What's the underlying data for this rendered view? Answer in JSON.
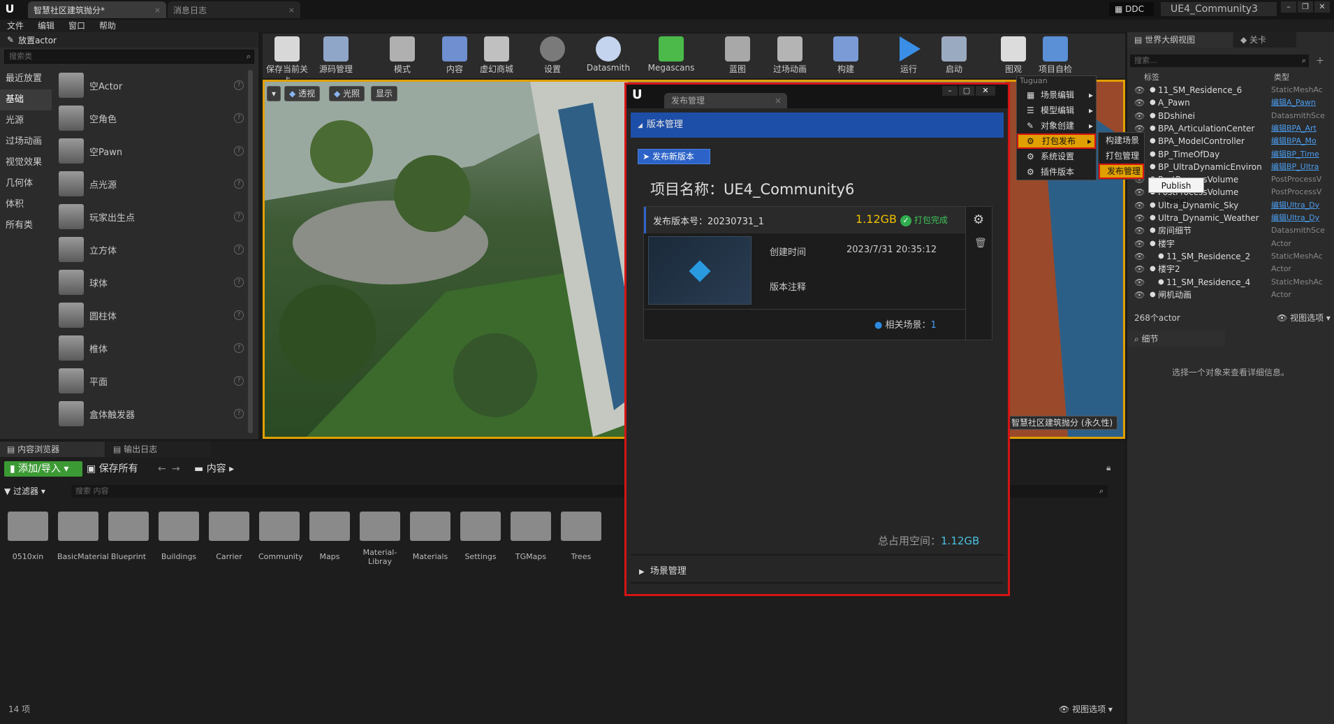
{
  "titlebar": {
    "tabs": [
      "智慧社区建筑抛分*",
      "消息日志"
    ],
    "ddc_label": "DDC",
    "project_name": "UE4_Community3"
  },
  "menubar": [
    "文件",
    "编辑",
    "窗口",
    "帮助"
  ],
  "left_panel": {
    "title": "放置actor",
    "search_placeholder": "搜索类",
    "categories": [
      "最近放置",
      "基础",
      "光源",
      "过场动画",
      "视觉效果",
      "几何体",
      "体积",
      "所有类"
    ],
    "actors": [
      "空Actor",
      "空角色",
      "空Pawn",
      "点光源",
      "玩家出生点",
      "立方体",
      "球体",
      "圆柱体",
      "椎体",
      "平面",
      "盒体触发器"
    ]
  },
  "toolbar": {
    "buttons": [
      "保存当前关卡",
      "源码管理",
      "模式",
      "内容",
      "虚幻商城",
      "设置",
      "Datasmith",
      "Megascans",
      "蓝图",
      "过场动画",
      "构建",
      "运行",
      "启动",
      "图观",
      "项目自检"
    ]
  },
  "viewport": {
    "buttons": [
      "透视",
      "光照",
      "显示"
    ],
    "bottom_label": "智慧社区建筑抛分 (永久性)"
  },
  "dialog": {
    "tab_title": "发布管理",
    "section_version": "版本管理",
    "publish_button": "发布新版本",
    "project_label": "项目名称：UE4_Community6",
    "version_label": "发布版本号：20230731_1",
    "size": "1.12GB",
    "status": "打包完成",
    "created_label": "创建时间",
    "created_value": "2023/7/31 20:35:12",
    "notes_label": "版本注释",
    "related_label": "相关场景：",
    "related_count": "1",
    "total_label": "总占用空间：",
    "total_value": "1.12GB",
    "section_scene": "场景管理"
  },
  "context_menu": {
    "header": "Tuguan",
    "items": [
      "场景编辑",
      "模型编辑",
      "对象创建",
      "打包发布",
      "系统设置",
      "插件版本"
    ],
    "submenu": [
      "构建场景",
      "打包管理",
      "发布管理"
    ],
    "tooltip": "Publish Panel"
  },
  "content_browser": {
    "tabs": [
      "内容浏览器",
      "输出日志"
    ],
    "add_button": "添加/导入",
    "save_all": "保存所有",
    "path": "内容",
    "filter": "过滤器",
    "search_placeholder": "搜索 内容",
    "folders": [
      "0510xin",
      "BasicMaterial",
      "Blueprint",
      "Buildings",
      "Carrier",
      "Community",
      "Maps",
      "Material-Libray",
      "Materials",
      "Settings",
      "TGMaps",
      "Trees"
    ],
    "item_count": "14 项",
    "view_options": "视图选项"
  },
  "outliner": {
    "tabs": [
      "世界大纲视图",
      "关卡"
    ],
    "search_placeholder": "搜索...",
    "col_label": "标签",
    "col_type": "类型",
    "rows": [
      {
        "name": "11_SM_Residence_6",
        "type": "StaticMeshAc",
        "link": false
      },
      {
        "name": "A_Pawn",
        "type": "编辑A_Pawn",
        "link": true
      },
      {
        "name": "BDshinei",
        "type": "DatasmithSce",
        "link": false
      },
      {
        "name": "BPA_ArticulationCenter",
        "type": "编辑BPA_Art",
        "link": true
      },
      {
        "name": "BPA_ModelController",
        "type": "编辑BPA_Mo",
        "link": true
      },
      {
        "name": "BP_TimeOfDay",
        "type": "编辑BP_Time",
        "link": true
      },
      {
        "name": "BP_UltraDynamicEnviron",
        "type": "编辑BP_Ultra",
        "link": true
      },
      {
        "name": "PostProcessVolume",
        "type": "PostProcessV",
        "link": false
      },
      {
        "name": "PostProcessVolume",
        "type": "PostProcessV",
        "link": false
      },
      {
        "name": "Ultra_Dynamic_Sky",
        "type": "编辑Ultra_Dy",
        "link": true
      },
      {
        "name": "Ultra_Dynamic_Weather",
        "type": "编辑Ultra_Dy",
        "link": true
      },
      {
        "name": "房间细节",
        "type": "DatasmithSce",
        "link": false
      },
      {
        "name": "楼宇",
        "type": "Actor",
        "link": false
      },
      {
        "name": "11_SM_Residence_2",
        "type": "StaticMeshAc",
        "link": false
      },
      {
        "name": "楼宇2",
        "type": "Actor",
        "link": false
      },
      {
        "name": "11_SM_Residence_4",
        "type": "StaticMeshAc",
        "link": false
      },
      {
        "name": "闸机动画",
        "type": "Actor",
        "link": false
      }
    ],
    "actor_count": "268个actor",
    "view_options": "视图选项",
    "details_tab": "细节",
    "details_hint": "选择一个对象来查看详细信息。"
  },
  "colors": {
    "accent": "#e0a000",
    "highlight_border": "#d61414",
    "link": "#4b9ef0",
    "blue_header": "#1e4fa8"
  }
}
